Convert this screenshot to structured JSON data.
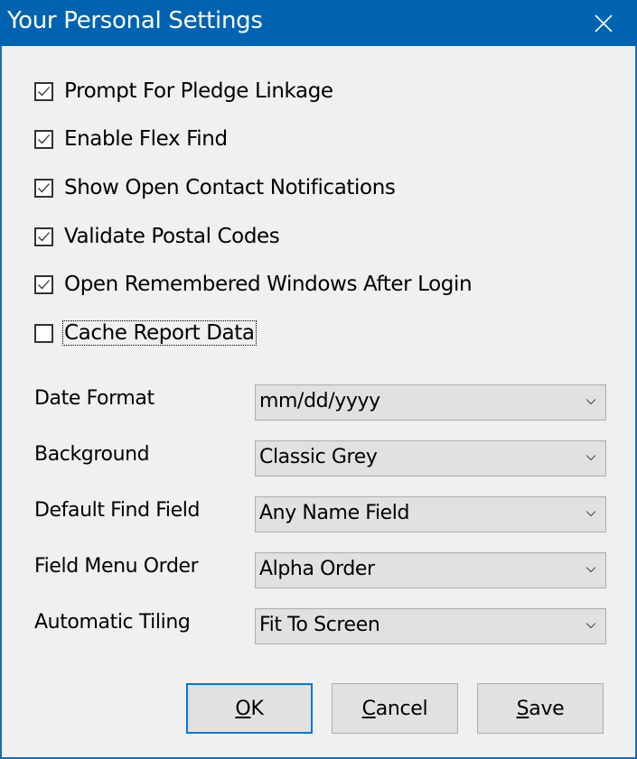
{
  "window": {
    "title": "Your Personal Settings",
    "close_icon": "close-icon"
  },
  "checkboxes": [
    {
      "label": "Prompt For Pledge Linkage",
      "checked": true
    },
    {
      "label": "Enable Flex Find",
      "checked": true
    },
    {
      "label": "Show Open Contact Notifications",
      "checked": true
    },
    {
      "label": "Validate Postal Codes",
      "checked": true
    },
    {
      "label": "Open Remembered Windows After Login",
      "checked": true
    },
    {
      "label": "Cache Report Data",
      "checked": false,
      "focused": true
    }
  ],
  "fields": [
    {
      "label": "Date Format",
      "value": "mm/dd/yyyy"
    },
    {
      "label": "Background",
      "value": "Classic Grey"
    },
    {
      "label": "Default Find Field",
      "value": "Any Name Field"
    },
    {
      "label": "Field Menu Order",
      "value": "Alpha Order"
    },
    {
      "label": "Automatic Tiling",
      "value": "Fit To Screen"
    }
  ],
  "buttons": {
    "ok": {
      "mnemonic": "O",
      "rest": "K",
      "default": true
    },
    "cancel": {
      "mnemonic": "C",
      "rest": "ancel"
    },
    "save": {
      "mnemonic": "S",
      "rest": "ave"
    }
  },
  "colors": {
    "titlebar": "#0063b1",
    "border": "#1a6bb5",
    "focus_button": "#0078d7",
    "background": "#f0f0f0"
  }
}
